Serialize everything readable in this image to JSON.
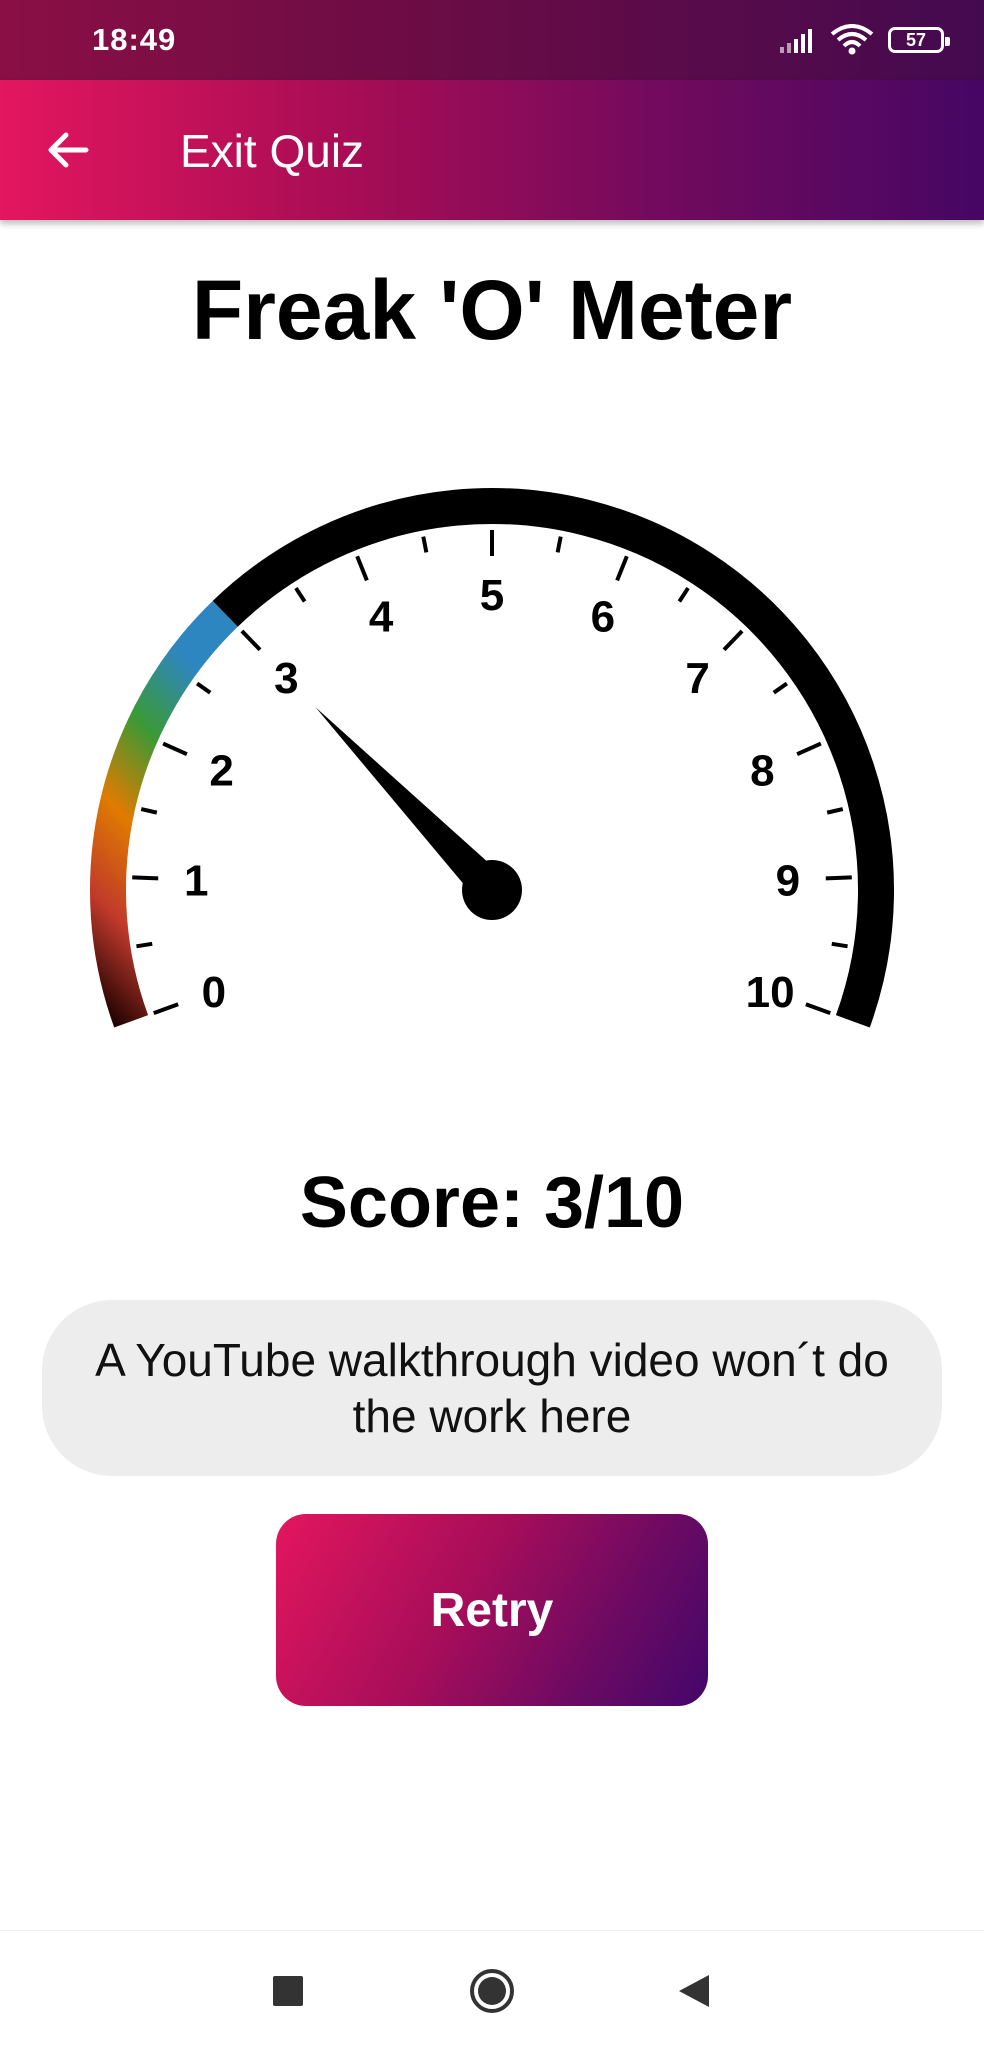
{
  "status_bar": {
    "time": "18:49",
    "battery": "57"
  },
  "app_bar": {
    "title": "Exit Quiz"
  },
  "page_title": "Freak 'O' Meter",
  "gauge": {
    "value": 3,
    "min": 0,
    "max": 10,
    "tick_labels": [
      "0",
      "1",
      "2",
      "3",
      "4",
      "5",
      "6",
      "7",
      "8",
      "9",
      "10"
    ],
    "colors": {
      "track": "#000000",
      "gradient": [
        "#1a0000",
        "#c0392b",
        "#e07b00",
        "#3a9a35",
        "#2e86c1"
      ]
    }
  },
  "score_text": "Score: 3/10",
  "message": "A YouTube walkthrough video won´t do the work here",
  "retry_label": "Retry",
  "icons": {
    "back": "arrow-left-icon",
    "recent": "square-icon",
    "home": "circle-home-icon",
    "nav_back": "triangle-back-icon"
  }
}
